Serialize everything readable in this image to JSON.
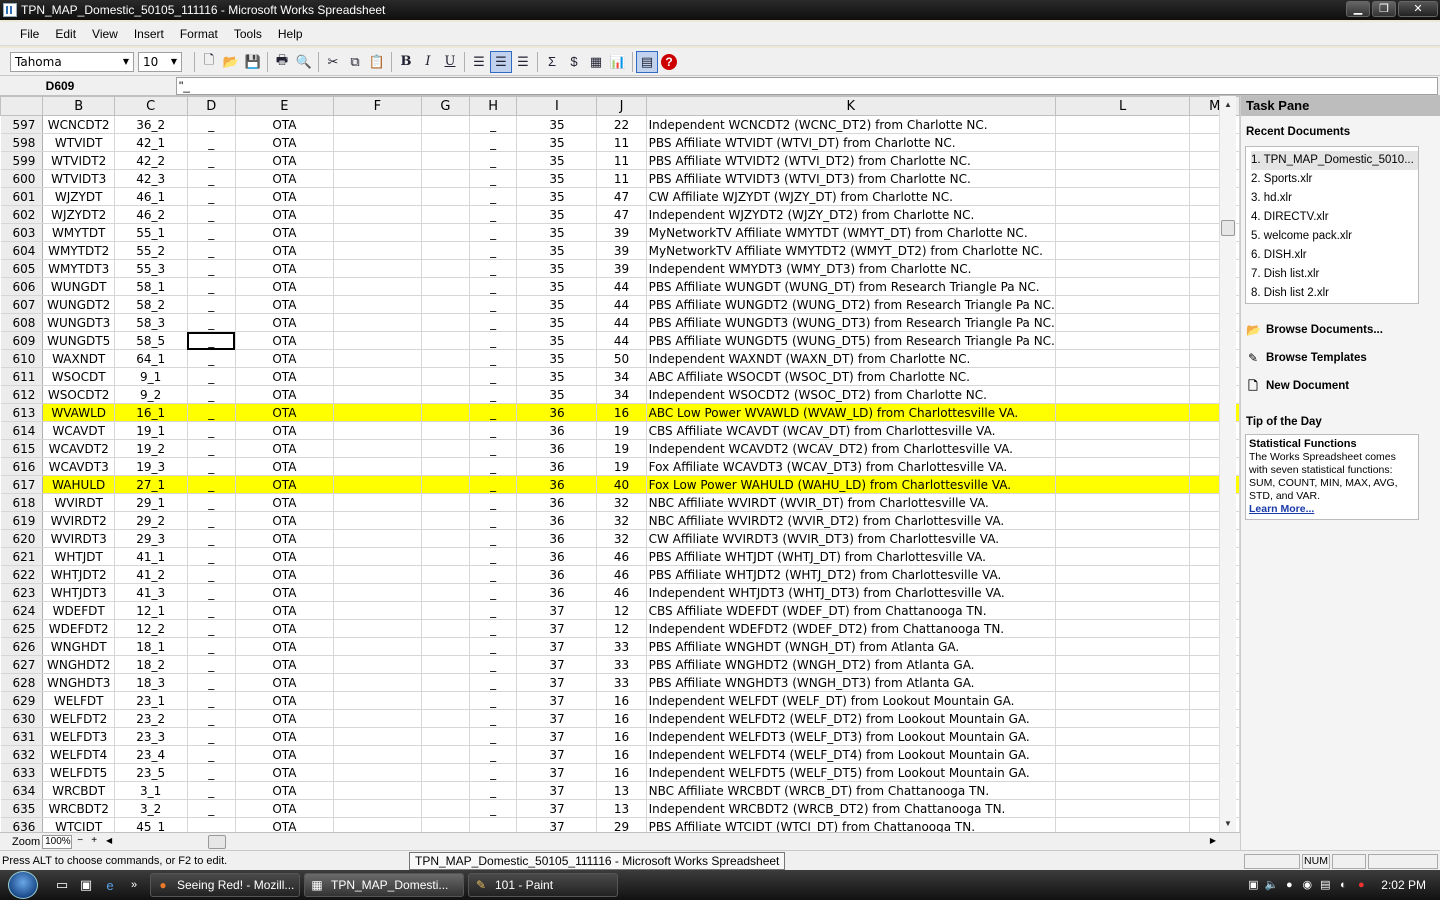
{
  "window": {
    "title": "TPN_MAP_Domestic_50105_111116 - Microsoft Works Spreadsheet"
  },
  "menu": [
    "File",
    "Edit",
    "View",
    "Insert",
    "Format",
    "Tools",
    "Help"
  ],
  "toolbar": {
    "font": "Tahoma",
    "size": "10",
    "bold": "B",
    "italic": "I",
    "underline": "U",
    "sum": "Σ",
    "currency": "$",
    "help": "?"
  },
  "formula_bar": {
    "cell_ref": "D609",
    "content": "\"_"
  },
  "columns": [
    "B",
    "C",
    "D",
    "E",
    "F",
    "G",
    "H",
    "I",
    "J",
    "K",
    "L",
    "M"
  ],
  "rows": [
    {
      "n": "597",
      "b": "WCNCDT2",
      "c": "36_2",
      "d": "_",
      "e": "OTA",
      "h": "_",
      "i": "35",
      "j": "22",
      "k": "Independent WCNCDT2 (WCNC_DT2) from Charlotte NC."
    },
    {
      "n": "598",
      "b": "WTVIDT",
      "c": "42_1",
      "d": "_",
      "e": "OTA",
      "h": "_",
      "i": "35",
      "j": "11",
      "k": "PBS Affiliate WTVIDT (WTVI_DT) from Charlotte NC."
    },
    {
      "n": "599",
      "b": "WTVIDT2",
      "c": "42_2",
      "d": "_",
      "e": "OTA",
      "h": "_",
      "i": "35",
      "j": "11",
      "k": "PBS Affiliate WTVIDT2 (WTVI_DT2) from Charlotte NC."
    },
    {
      "n": "600",
      "b": "WTVIDT3",
      "c": "42_3",
      "d": "_",
      "e": "OTA",
      "h": "_",
      "i": "35",
      "j": "11",
      "k": "PBS Affiliate WTVIDT3 (WTVI_DT3) from Charlotte NC."
    },
    {
      "n": "601",
      "b": "WJZYDT",
      "c": "46_1",
      "d": "_",
      "e": "OTA",
      "h": "_",
      "i": "35",
      "j": "47",
      "k": "CW Affiliate WJZYDT (WJZY_DT) from Charlotte NC."
    },
    {
      "n": "602",
      "b": "WJZYDT2",
      "c": "46_2",
      "d": "_",
      "e": "OTA",
      "h": "_",
      "i": "35",
      "j": "47",
      "k": "Independent WJZYDT2 (WJZY_DT2) from Charlotte NC."
    },
    {
      "n": "603",
      "b": "WMYTDT",
      "c": "55_1",
      "d": "_",
      "e": "OTA",
      "h": "_",
      "i": "35",
      "j": "39",
      "k": "MyNetworkTV Affiliate WMYTDT (WMYT_DT) from Charlotte NC."
    },
    {
      "n": "604",
      "b": "WMYTDT2",
      "c": "55_2",
      "d": "_",
      "e": "OTA",
      "h": "_",
      "i": "35",
      "j": "39",
      "k": "MyNetworkTV Affiliate WMYTDT2 (WMYT_DT2) from Charlotte NC."
    },
    {
      "n": "605",
      "b": "WMYTDT3",
      "c": "55_3",
      "d": "_",
      "e": "OTA",
      "h": "_",
      "i": "35",
      "j": "39",
      "k": "Independent WMYDT3 (WMY_DT3) from Charlotte NC."
    },
    {
      "n": "606",
      "b": "WUNGDT",
      "c": "58_1",
      "d": "_",
      "e": "OTA",
      "h": "_",
      "i": "35",
      "j": "44",
      "k": "PBS Affiliate WUNGDT (WUNG_DT) from Research Triangle Pa NC."
    },
    {
      "n": "607",
      "b": "WUNGDT2",
      "c": "58_2",
      "d": "_",
      "e": "OTA",
      "h": "_",
      "i": "35",
      "j": "44",
      "k": "PBS Affiliate WUNGDT2 (WUNG_DT2) from Research Triangle Pa NC."
    },
    {
      "n": "608",
      "b": "WUNGDT3",
      "c": "58_3",
      "d": "_",
      "e": "OTA",
      "h": "_",
      "i": "35",
      "j": "44",
      "k": "PBS Affiliate WUNGDT3 (WUNG_DT3) from Research Triangle Pa NC."
    },
    {
      "n": "609",
      "b": "WUNGDT5",
      "c": "58_5",
      "d": "_",
      "e": "OTA",
      "h": "_",
      "i": "35",
      "j": "44",
      "k": "PBS Affiliate WUNGDT5 (WUNG_DT5) from Research Triangle Pa NC.",
      "selected": true
    },
    {
      "n": "610",
      "b": "WAXNDT",
      "c": "64_1",
      "d": "_",
      "e": "OTA",
      "h": "_",
      "i": "35",
      "j": "50",
      "k": "Independent WAXNDT (WAXN_DT) from Charlotte NC."
    },
    {
      "n": "611",
      "b": "WSOCDT",
      "c": "9_1",
      "d": "_",
      "e": "OTA",
      "h": "_",
      "i": "35",
      "j": "34",
      "k": "ABC Affiliate WSOCDT (WSOC_DT) from Charlotte NC."
    },
    {
      "n": "612",
      "b": "WSOCDT2",
      "c": "9_2",
      "d": "_",
      "e": "OTA",
      "h": "_",
      "i": "35",
      "j": "34",
      "k": "Independent WSOCDT2 (WSOC_DT2) from Charlotte NC."
    },
    {
      "n": "613",
      "b": "WVAWLD",
      "c": "16_1",
      "d": "_",
      "e": "OTA",
      "h": "_",
      "i": "36",
      "j": "16",
      "k": "ABC Low Power WVAWLD (WVAW_LD) from Charlottesville VA.",
      "highlight": true
    },
    {
      "n": "614",
      "b": "WCAVDT",
      "c": "19_1",
      "d": "_",
      "e": "OTA",
      "h": "_",
      "i": "36",
      "j": "19",
      "k": "CBS Affiliate WCAVDT (WCAV_DT) from Charlottesville VA."
    },
    {
      "n": "615",
      "b": "WCAVDT2",
      "c": "19_2",
      "d": "_",
      "e": "OTA",
      "h": "_",
      "i": "36",
      "j": "19",
      "k": "Independent WCAVDT2 (WCAV_DT2) from Charlottesville VA."
    },
    {
      "n": "616",
      "b": "WCAVDT3",
      "c": "19_3",
      "d": "_",
      "e": "OTA",
      "h": "_",
      "i": "36",
      "j": "19",
      "k": "Fox Affiliate WCAVDT3 (WCAV_DT3) from Charlottesville VA."
    },
    {
      "n": "617",
      "b": "WAHULD",
      "c": "27_1",
      "d": "_",
      "e": "OTA",
      "h": "_",
      "i": "36",
      "j": "40",
      "k": "Fox Low Power WAHULD (WAHU_LD) from Charlottesville VA.",
      "highlight": true
    },
    {
      "n": "618",
      "b": "WVIRDT",
      "c": "29_1",
      "d": "_",
      "e": "OTA",
      "h": "_",
      "i": "36",
      "j": "32",
      "k": "NBC Affiliate WVIRDT (WVIR_DT) from Charlottesville VA."
    },
    {
      "n": "619",
      "b": "WVIRDT2",
      "c": "29_2",
      "d": "_",
      "e": "OTA",
      "h": "_",
      "i": "36",
      "j": "32",
      "k": "NBC Affiliate WVIRDT2 (WVIR_DT2) from Charlottesville VA."
    },
    {
      "n": "620",
      "b": "WVIRDT3",
      "c": "29_3",
      "d": "_",
      "e": "OTA",
      "h": "_",
      "i": "36",
      "j": "32",
      "k": "CW Affiliate WVIRDT3 (WVIR_DT3) from Charlottesville VA."
    },
    {
      "n": "621",
      "b": "WHTJDT",
      "c": "41_1",
      "d": "_",
      "e": "OTA",
      "h": "_",
      "i": "36",
      "j": "46",
      "k": "PBS Affiliate WHTJDT (WHTJ_DT) from Charlottesville VA."
    },
    {
      "n": "622",
      "b": "WHTJDT2",
      "c": "41_2",
      "d": "_",
      "e": "OTA",
      "h": "_",
      "i": "36",
      "j": "46",
      "k": "PBS Affiliate WHTJDT2 (WHTJ_DT2) from Charlottesville VA."
    },
    {
      "n": "623",
      "b": "WHTJDT3",
      "c": "41_3",
      "d": "_",
      "e": "OTA",
      "h": "_",
      "i": "36",
      "j": "46",
      "k": "Independent WHTJDT3 (WHTJ_DT3) from Charlottesville VA."
    },
    {
      "n": "624",
      "b": "WDEFDT",
      "c": "12_1",
      "d": "_",
      "e": "OTA",
      "h": "_",
      "i": "37",
      "j": "12",
      "k": "CBS Affiliate WDEFDT (WDEF_DT) from Chattanooga TN."
    },
    {
      "n": "625",
      "b": "WDEFDT2",
      "c": "12_2",
      "d": "_",
      "e": "OTA",
      "h": "_",
      "i": "37",
      "j": "12",
      "k": "Independent WDEFDT2 (WDEF_DT2) from Chattanooga TN."
    },
    {
      "n": "626",
      "b": "WNGHDT",
      "c": "18_1",
      "d": "_",
      "e": "OTA",
      "h": "_",
      "i": "37",
      "j": "33",
      "k": "PBS Affiliate WNGHDT (WNGH_DT) from Atlanta GA."
    },
    {
      "n": "627",
      "b": "WNGHDT2",
      "c": "18_2",
      "d": "_",
      "e": "OTA",
      "h": "_",
      "i": "37",
      "j": "33",
      "k": "PBS Affiliate WNGHDT2 (WNGH_DT2) from Atlanta GA."
    },
    {
      "n": "628",
      "b": "WNGHDT3",
      "c": "18_3",
      "d": "_",
      "e": "OTA",
      "h": "_",
      "i": "37",
      "j": "33",
      "k": "PBS Affiliate WNGHDT3 (WNGH_DT3) from Atlanta GA."
    },
    {
      "n": "629",
      "b": "WELFDT",
      "c": "23_1",
      "d": "_",
      "e": "OTA",
      "h": "_",
      "i": "37",
      "j": "16",
      "k": "Independent WELFDT (WELF_DT) from Lookout Mountain GA."
    },
    {
      "n": "630",
      "b": "WELFDT2",
      "c": "23_2",
      "d": "_",
      "e": "OTA",
      "h": "_",
      "i": "37",
      "j": "16",
      "k": "Independent WELFDT2 (WELF_DT2) from Lookout Mountain GA."
    },
    {
      "n": "631",
      "b": "WELFDT3",
      "c": "23_3",
      "d": "_",
      "e": "OTA",
      "h": "_",
      "i": "37",
      "j": "16",
      "k": "Independent WELFDT3 (WELF_DT3) from Lookout Mountain GA."
    },
    {
      "n": "632",
      "b": "WELFDT4",
      "c": "23_4",
      "d": "_",
      "e": "OTA",
      "h": "_",
      "i": "37",
      "j": "16",
      "k": "Independent WELFDT4 (WELF_DT4) from Lookout Mountain GA."
    },
    {
      "n": "633",
      "b": "WELFDT5",
      "c": "23_5",
      "d": "_",
      "e": "OTA",
      "h": "_",
      "i": "37",
      "j": "16",
      "k": "Independent WELFDT5 (WELF_DT5) from Lookout Mountain GA."
    },
    {
      "n": "634",
      "b": "WRCBDT",
      "c": "3_1",
      "d": "_",
      "e": "OTA",
      "h": "_",
      "i": "37",
      "j": "13",
      "k": "NBC Affiliate WRCBDT (WRCB_DT) from Chattanooga TN."
    },
    {
      "n": "635",
      "b": "WRCBDT2",
      "c": "3_2",
      "d": "_",
      "e": "OTA",
      "h": "_",
      "i": "37",
      "j": "13",
      "k": "Independent WRCBDT2 (WRCB_DT2) from Chattanooga TN."
    },
    {
      "n": "636",
      "b": "WTCIDT",
      "c": "45_1",
      "d": "_",
      "e": "OTA",
      "h": "_",
      "i": "37",
      "j": "29",
      "k": "PBS Affiliate WTCIDT (WTCI_DT) from Chattanooga TN."
    }
  ],
  "highlight_color": "#ffff00",
  "zoom": {
    "label": "Zoom",
    "value": "100%",
    "minus": "−",
    "plus": "+"
  },
  "task_pane": {
    "title": "Task Pane",
    "recent_title": "Recent Documents",
    "recent_docs": [
      "1. TPN_MAP_Domestic_5010...",
      "2. Sports.xlr",
      "3. hd.xlr",
      "4. DIRECTV.xlr",
      "5. welcome pack.xlr",
      "6. DISH.xlr",
      "7. Dish list.xlr",
      "8. Dish list 2.xlr"
    ],
    "links": [
      "Browse Documents...",
      "Browse Templates",
      "New Document"
    ],
    "tip_title": "Tip of the Day",
    "tip_heading": "Statistical Functions",
    "tip_body": "The Works Spreadsheet comes with seven statistical functions: SUM, COUNT, MIN, MAX, AVG, STD, and VAR.",
    "tip_link": "Learn More..."
  },
  "status": {
    "message": "Press ALT to choose commands, or F2 to edit.",
    "tooltip": "TPN_MAP_Domestic_50105_111116 - Microsoft Works Spreadsheet",
    "num": "NUM"
  },
  "taskbar": {
    "items": [
      "Seeing Red! - Mozill...",
      "TPN_MAP_Domesti...",
      "101 - Paint"
    ],
    "clock": "2:02 PM"
  }
}
